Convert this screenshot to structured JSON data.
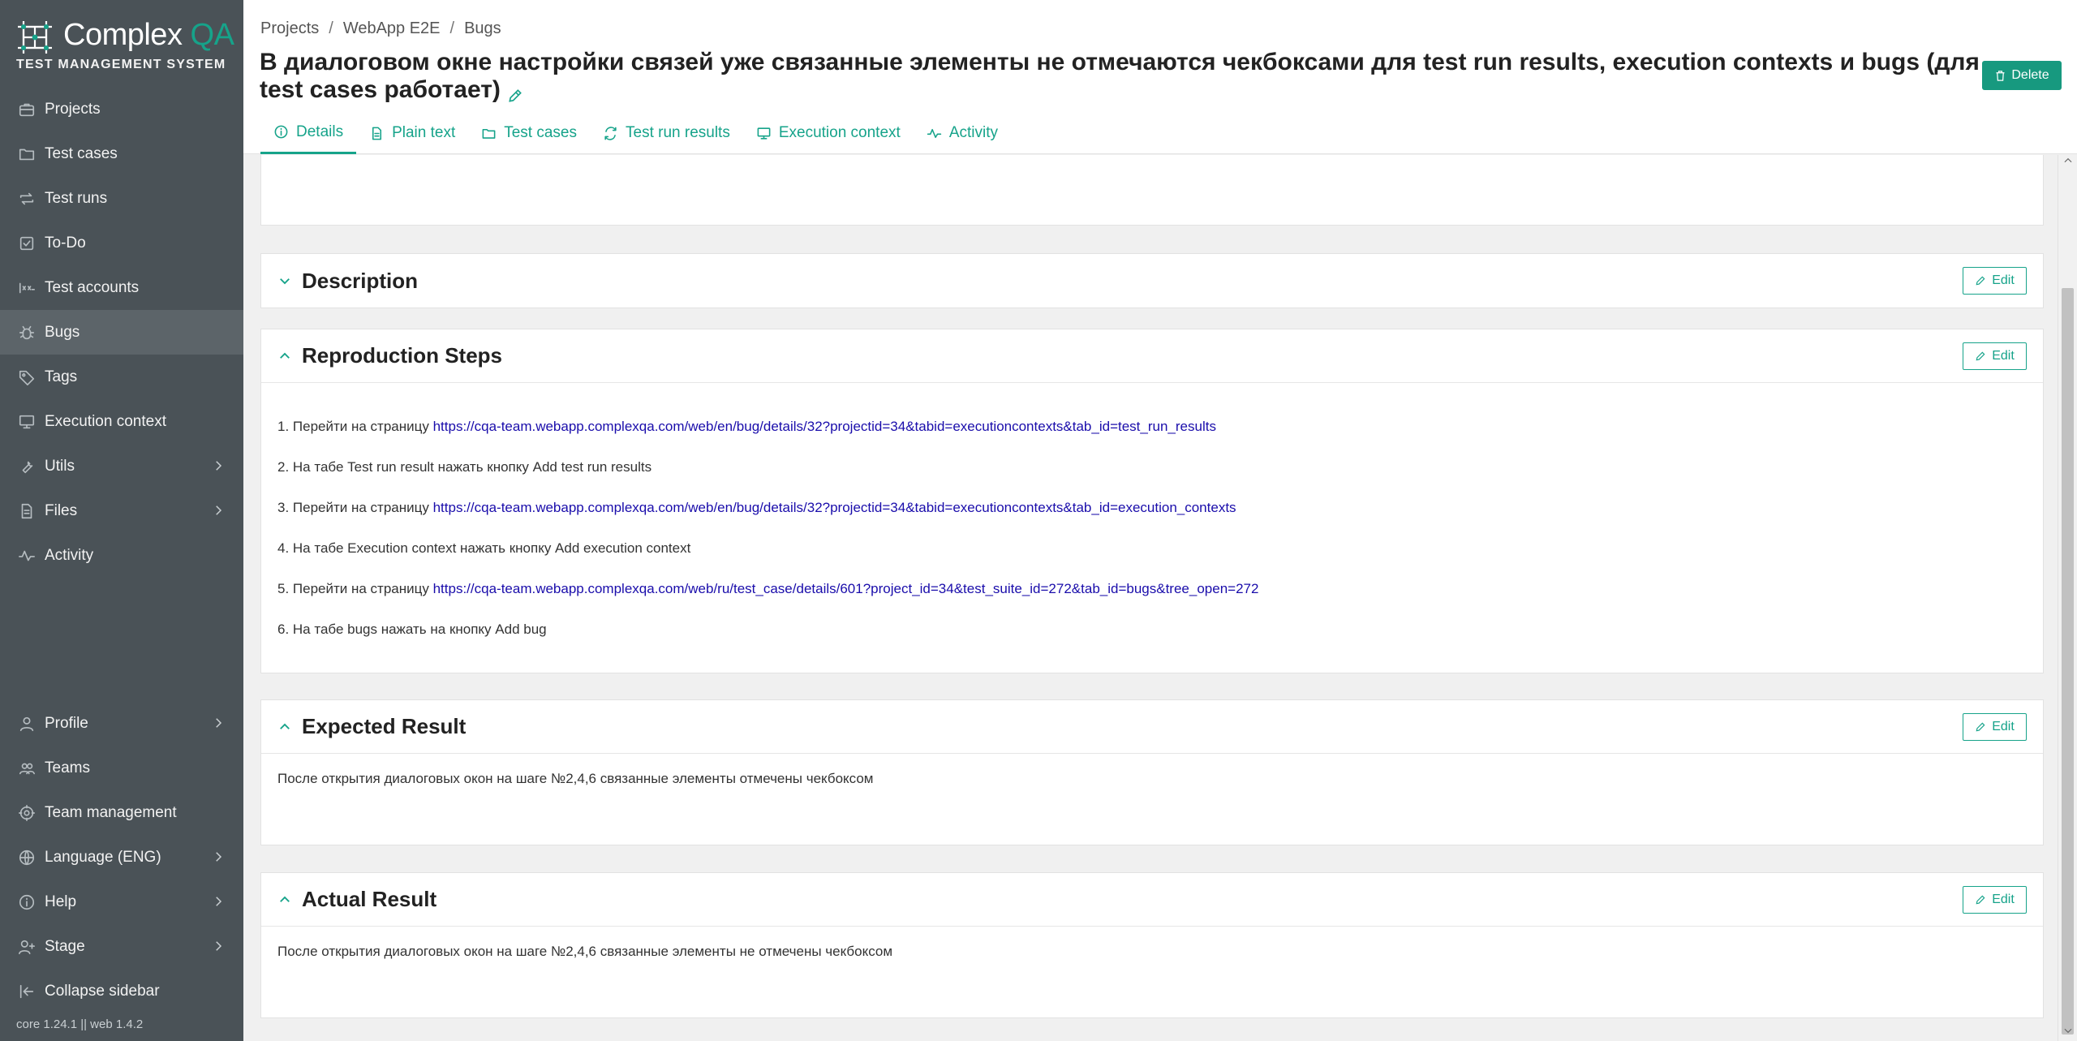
{
  "app": {
    "logo_name": "Complex",
    "logo_accent": "QA",
    "logo_subtitle": "TEST MANAGEMENT SYSTEM",
    "version": "core 1.24.1 || web 1.4.2"
  },
  "sidebar": {
    "items": [
      {
        "label": "Projects",
        "icon": "briefcase-icon"
      },
      {
        "label": "Test cases",
        "icon": "folder-icon"
      },
      {
        "label": "Test runs",
        "icon": "repeat-icon"
      },
      {
        "label": "To-Do",
        "icon": "checkbox-icon"
      },
      {
        "label": "Test accounts",
        "icon": "password-icon"
      },
      {
        "label": "Bugs",
        "icon": "bug-icon",
        "active": true
      },
      {
        "label": "Tags",
        "icon": "tag-icon"
      },
      {
        "label": "Execution context",
        "icon": "monitor-icon"
      },
      {
        "label": "Utils",
        "icon": "wrench-icon",
        "expandable": true
      },
      {
        "label": "Files",
        "icon": "files-icon",
        "expandable": true
      },
      {
        "label": "Activity",
        "icon": "activity-icon"
      }
    ],
    "bottom_items": [
      {
        "label": "Profile",
        "icon": "user-icon",
        "expandable": true
      },
      {
        "label": "Teams",
        "icon": "team-icon"
      },
      {
        "label": "Team management",
        "icon": "gear-icon"
      },
      {
        "label": "Language (ENG)",
        "icon": "globe-icon",
        "expandable": true
      },
      {
        "label": "Help",
        "icon": "info-icon",
        "expandable": true
      },
      {
        "label": "Stage",
        "icon": "user-plus-icon",
        "expandable": true
      },
      {
        "label": "Collapse sidebar",
        "icon": "collapse-icon"
      }
    ]
  },
  "breadcrumb": [
    "Projects",
    "WebApp E2E",
    "Bugs"
  ],
  "page": {
    "title": "В диалоговом окне настройки связей уже связанные элементы не отмечаются чекбоксами для test run results, execution contexts и bugs (для test cases работает)",
    "delete_label": "Delete"
  },
  "tabs": [
    {
      "label": "Details",
      "icon": "info-icon",
      "active": true
    },
    {
      "label": "Plain text",
      "icon": "document-icon"
    },
    {
      "label": "Test cases",
      "icon": "folder-icon"
    },
    {
      "label": "Test run results",
      "icon": "refresh-icon"
    },
    {
      "label": "Execution context",
      "icon": "monitor-icon"
    },
    {
      "label": "Activity",
      "icon": "activity-icon"
    }
  ],
  "sections": {
    "edit_label": "Edit",
    "description": {
      "title": "Description"
    },
    "reproduction": {
      "title": "Reproduction Steps",
      "steps": [
        {
          "text": "1. Перейти на страницу ",
          "link": "https://cqa-team.webapp.complexqa.com/web/en/bug/details/32?projectid=34&tabid=executioncontexts&tab_id=test_run_results"
        },
        {
          "text": "2. На табе Test run result нажать кнопку Add test run results",
          "link": ""
        },
        {
          "text": "3. Перейти на страницу ",
          "link": "https://cqa-team.webapp.complexqa.com/web/en/bug/details/32?projectid=34&tabid=executioncontexts&tab_id=execution_contexts"
        },
        {
          "text": "4. На табе Execution context нажать кнопку Add execution context",
          "link": ""
        },
        {
          "text": "5. Перейти на страницу ",
          "link": "https://cqa-team.webapp.complexqa.com/web/ru/test_case/details/601?project_id=34&test_suite_id=272&tab_id=bugs&tree_open=272"
        },
        {
          "text": "6. На табе bugs нажать на кнопку Add bug",
          "link": ""
        }
      ]
    },
    "expected": {
      "title": "Expected Result",
      "text": "После открытия диалоговых окон на шаге №2,4,6 связанные элементы отмечены чекбоксом"
    },
    "actual": {
      "title": "Actual Result",
      "text": "После открытия диалоговых окон на шаге №2,4,6 связанные элементы не отмечены чекбоксом"
    }
  },
  "colors": {
    "accent": "#16a38a",
    "sidebar_bg": "#4a5257",
    "sidebar_active": "#5c6469",
    "delete_bg": "#17997f",
    "link": "#1a0dab"
  }
}
